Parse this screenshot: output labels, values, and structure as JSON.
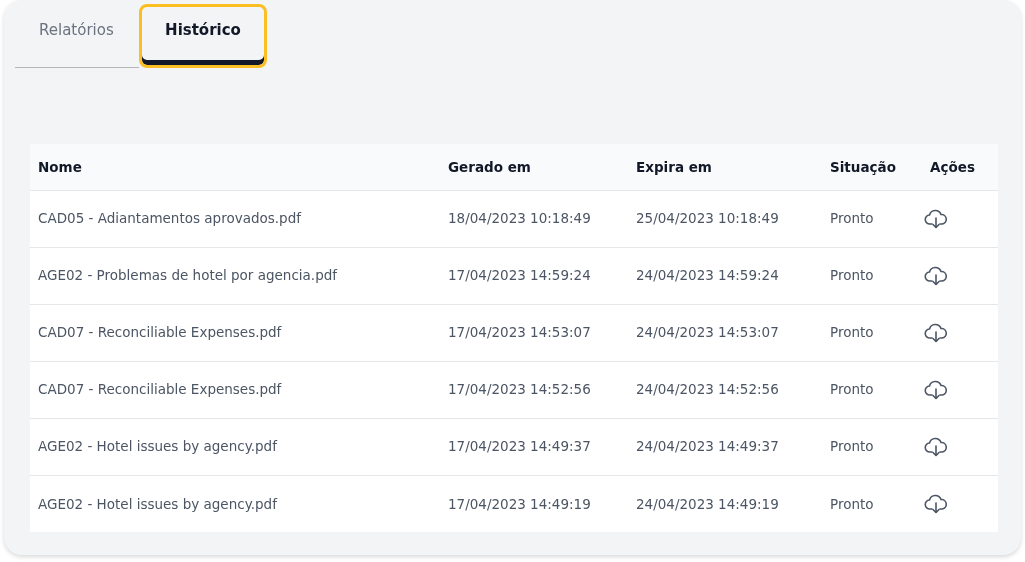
{
  "tabs": [
    {
      "label": "Relatórios",
      "selected": false
    },
    {
      "label": "Histórico",
      "selected": true
    }
  ],
  "table": {
    "columns": [
      "Nome",
      "Gerado em",
      "Expira em",
      "Situação",
      "Ações"
    ],
    "rows": [
      {
        "name": "CAD05 - Adiantamentos aprovados.pdf",
        "generated": "18/04/2023 10:18:49",
        "expires": "25/04/2023 10:18:49",
        "status": "Pronto"
      },
      {
        "name": "AGE02 - Problemas de hotel por agencia.pdf",
        "generated": "17/04/2023 14:59:24",
        "expires": "24/04/2023 14:59:24",
        "status": "Pronto"
      },
      {
        "name": "CAD07 - Reconciliable Expenses.pdf",
        "generated": "17/04/2023 14:53:07",
        "expires": "24/04/2023 14:53:07",
        "status": "Pronto"
      },
      {
        "name": "CAD07 - Reconciliable Expenses.pdf",
        "generated": "17/04/2023 14:52:56",
        "expires": "24/04/2023 14:52:56",
        "status": "Pronto"
      },
      {
        "name": "AGE02 - Hotel issues by agency.pdf",
        "generated": "17/04/2023 14:49:37",
        "expires": "24/04/2023 14:49:37",
        "status": "Pronto"
      },
      {
        "name": "AGE02 - Hotel issues by agency.pdf",
        "generated": "17/04/2023 14:49:19",
        "expires": "24/04/2023 14:49:19",
        "status": "Pronto"
      }
    ]
  }
}
